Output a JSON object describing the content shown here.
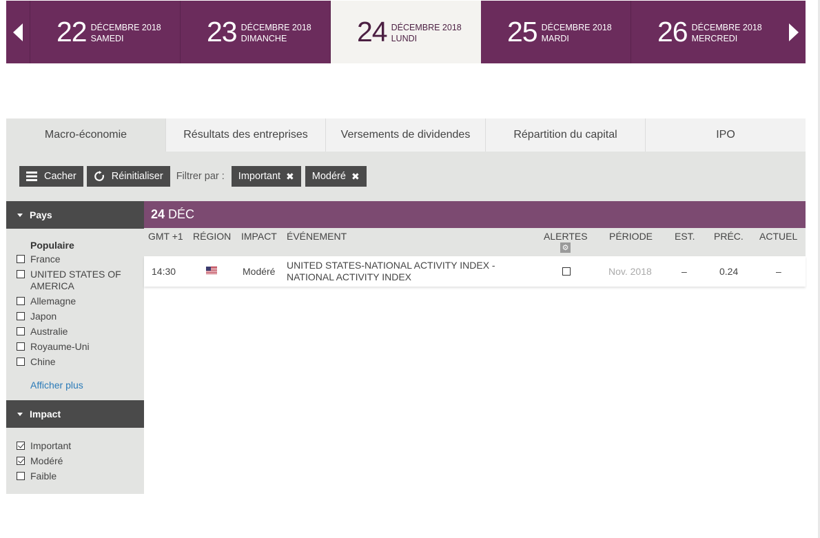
{
  "datebar": {
    "days": [
      {
        "num": "22",
        "month": "DÉCEMBRE 2018",
        "weekday": "SAMEDI"
      },
      {
        "num": "23",
        "month": "DÉCEMBRE 2018",
        "weekday": "DIMANCHE"
      },
      {
        "num": "24",
        "month": "DÉCEMBRE 2018",
        "weekday": "LUNDI"
      },
      {
        "num": "25",
        "month": "DÉCEMBRE 2018",
        "weekday": "MARDI"
      },
      {
        "num": "26",
        "month": "DÉCEMBRE 2018",
        "weekday": "MERCREDI"
      }
    ],
    "active_index": 2
  },
  "tabs": [
    {
      "label": "Macro-économie"
    },
    {
      "label": "Résultats des entreprises"
    },
    {
      "label": "Versements de dividendes"
    },
    {
      "label": "Répartition du capital"
    },
    {
      "label": "IPO"
    }
  ],
  "filters": {
    "hide_label": "Cacher",
    "reset_label": "Réinitialiser",
    "filter_by_label": "Filtrer par :",
    "chips": [
      {
        "label": "Important"
      },
      {
        "label": "Modéré"
      }
    ]
  },
  "sidebar": {
    "country_title": "Pays",
    "popular_label": "Populaire",
    "countries": [
      {
        "label": "France",
        "checked": false
      },
      {
        "label": "UNITED STATES OF AMERICA",
        "checked": false
      },
      {
        "label": "Allemagne",
        "checked": false
      },
      {
        "label": "Japon",
        "checked": false
      },
      {
        "label": "Australie",
        "checked": false
      },
      {
        "label": "Royaume-Uni",
        "checked": false
      },
      {
        "label": "Chine",
        "checked": false
      }
    ],
    "show_more": "Afficher plus",
    "impact_title": "Impact",
    "impacts": [
      {
        "label": "Important",
        "checked": true
      },
      {
        "label": "Modéré",
        "checked": true
      },
      {
        "label": "Faible",
        "checked": false
      }
    ]
  },
  "table": {
    "date_day": "24",
    "date_month": "DÉC",
    "columns": {
      "time": "GMT +1",
      "region": "RÉGION",
      "impact": "IMPACT",
      "event": "ÉVÉNEMENT",
      "alerts": "ALERTES",
      "period": "PÉRIODE",
      "est": "EST.",
      "prev": "PRÉC.",
      "actual": "ACTUEL"
    },
    "rows": [
      {
        "time": "14:30",
        "region_icon": "us-flag-icon",
        "impact": "Modéré",
        "event": "UNITED STATES-NATIONAL ACTIVITY INDEX - NATIONAL ACTIVITY INDEX",
        "alert_checked": false,
        "period": "Nov. 2018",
        "est": "–",
        "prev": "0.24",
        "actual": "–"
      }
    ]
  },
  "colors": {
    "brand": "#6b2c5c",
    "brand_light": "#7c4a71",
    "panel": "#e3e4e2",
    "button": "#4a4a4a",
    "link": "#2a7ab8"
  }
}
